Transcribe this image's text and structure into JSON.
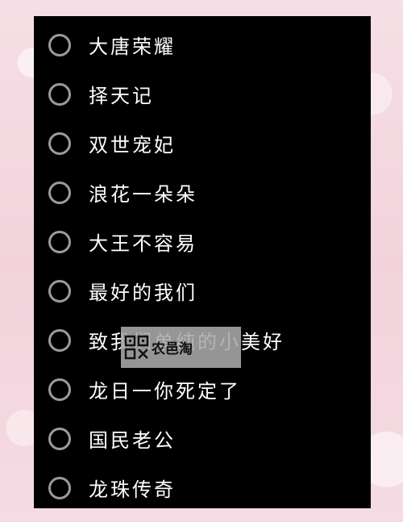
{
  "options": [
    {
      "label": "大唐荣耀"
    },
    {
      "label": "择天记"
    },
    {
      "label": "双世宠妃"
    },
    {
      "label": "浪花一朵朵"
    },
    {
      "label": "大王不容易"
    },
    {
      "label": "最好的我们"
    },
    {
      "label": "致我们单纯的小美好"
    },
    {
      "label": "龙日一你死定了"
    },
    {
      "label": "国民老公"
    },
    {
      "label": "龙珠传奇"
    }
  ],
  "watermark": {
    "text": "农邑淘",
    "logo_icon": "qr-logo-icon"
  },
  "colors": {
    "background": "#f3d6df",
    "panel": "#000000",
    "radio_border": "#9b9b9b",
    "text": "#ffffff"
  }
}
